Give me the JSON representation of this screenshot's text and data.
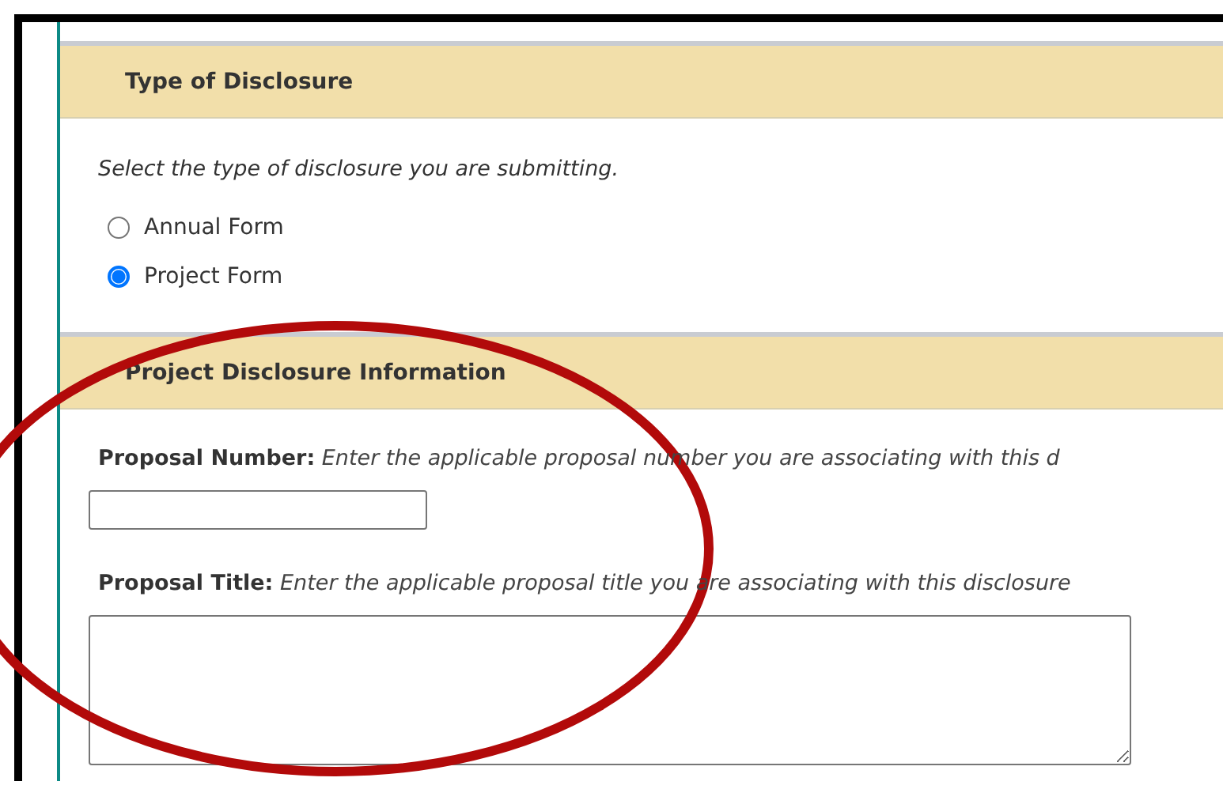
{
  "sections": [
    {
      "kind": "choice",
      "title": "Type of Disclosure",
      "prompt": "Select the type of disclosure you are submitting.",
      "options": [
        {
          "label": "Annual Form",
          "selected": false
        },
        {
          "label": "Project Form",
          "selected": true
        }
      ]
    },
    {
      "kind": "fields",
      "title": "Project Disclosure Information",
      "fields": [
        {
          "kind": "input",
          "label": "Proposal Number:",
          "hint": "Enter the applicable proposal number you are associating with this d"
        },
        {
          "kind": "textarea",
          "label": "Proposal Title:",
          "hint": "Enter the applicable proposal title you are associating with this disclosure"
        }
      ]
    }
  ]
}
